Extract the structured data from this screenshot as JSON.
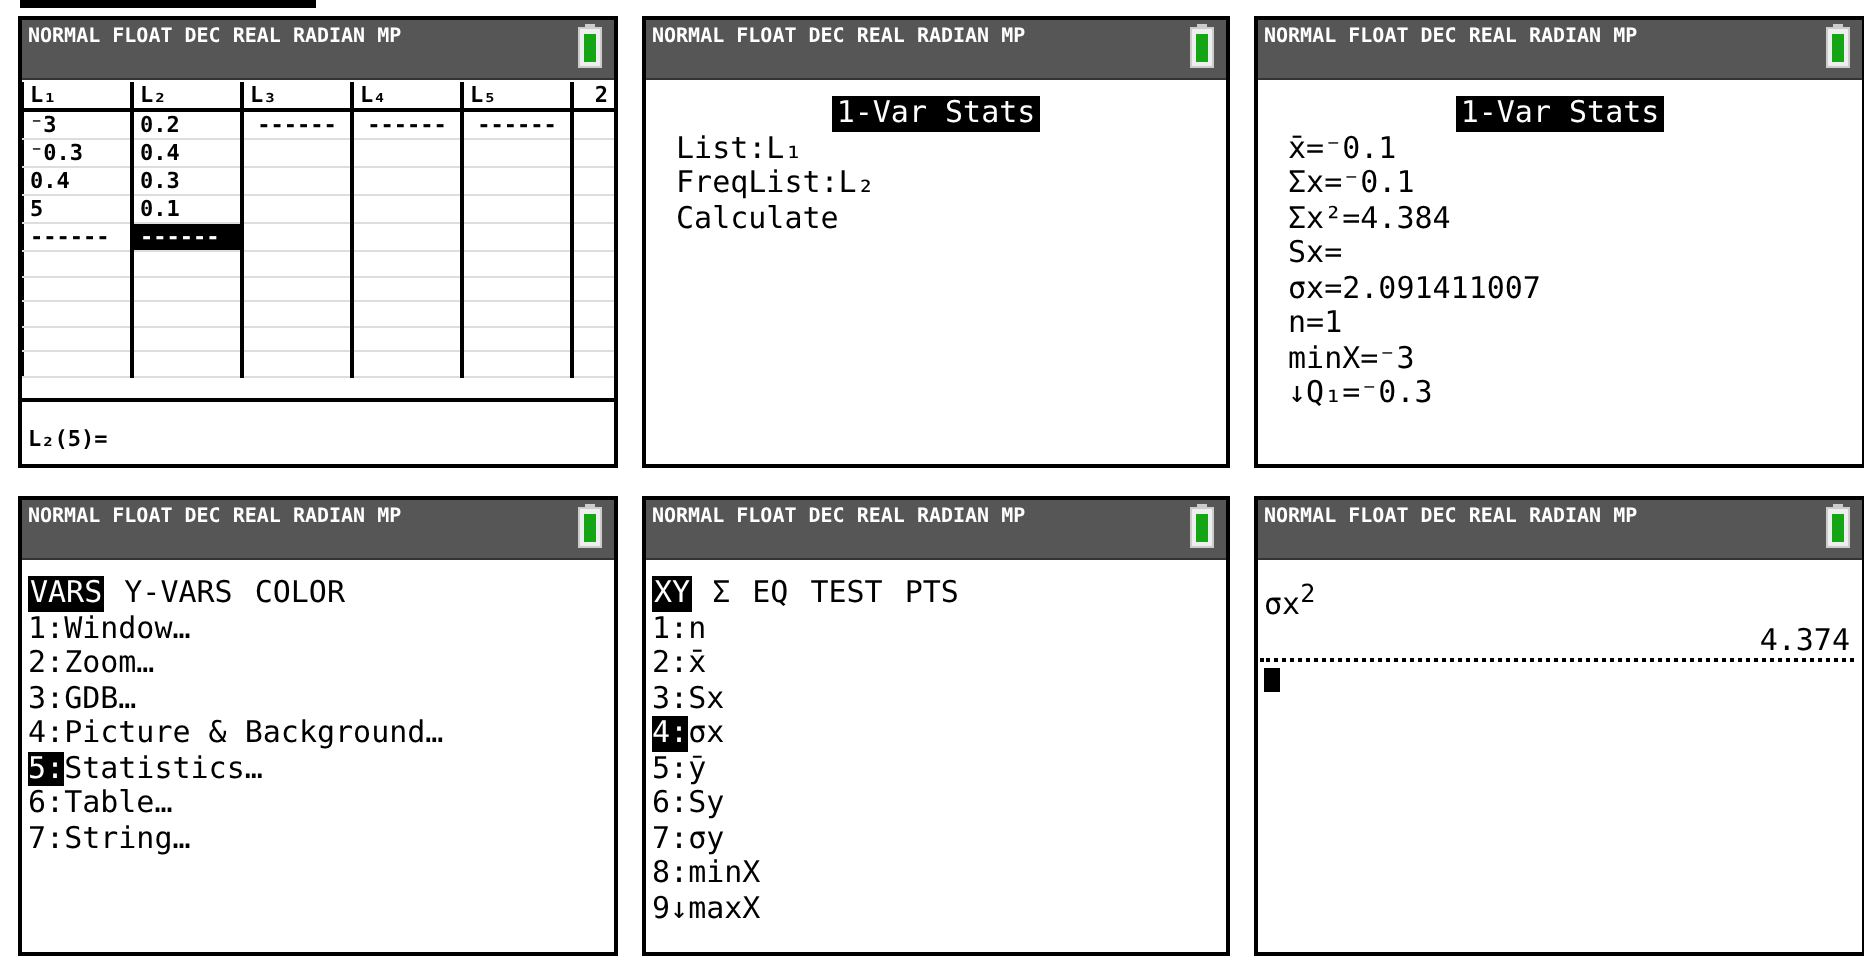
{
  "screens": [
    {
      "kind": "list_editor",
      "status": "NORMAL FLOAT DEC REAL RADIAN MP",
      "columns": [
        {
          "header": "L₁",
          "cells": [
            {
              "text": "⁻3",
              "selected": false
            },
            {
              "text": "⁻0.3",
              "selected": false
            },
            {
              "text": "0.4",
              "selected": false
            },
            {
              "text": "5",
              "selected": false
            },
            {
              "text": "------",
              "selected": false
            }
          ]
        },
        {
          "header": "L₂",
          "cells": [
            {
              "text": "0.2",
              "selected": false
            },
            {
              "text": "0.4",
              "selected": false
            },
            {
              "text": "0.3",
              "selected": false
            },
            {
              "text": "0.1",
              "selected": false
            },
            {
              "text": "------",
              "selected": true
            }
          ]
        },
        {
          "header": "L₃",
          "cells": [
            {
              "text": "------",
              "selected": false
            }
          ]
        },
        {
          "header": "L₄",
          "cells": [
            {
              "text": "------",
              "selected": false
            }
          ]
        },
        {
          "header": "L₅",
          "cells": [
            {
              "text": "------",
              "selected": false
            }
          ]
        },
        {
          "header": "2"
        }
      ],
      "entry": "L₂(5)="
    },
    {
      "kind": "stats",
      "status": "NORMAL FLOAT DEC REAL RADIAN MP",
      "title": "1-Var Stats",
      "lines": [
        "List:L₁",
        "FreqList:L₂",
        "Calculate"
      ]
    },
    {
      "kind": "stats",
      "status": "NORMAL FLOAT DEC REAL RADIAN MP",
      "title": "1-Var Stats",
      "lines": [
        "x̄=⁻0.1",
        "Σx=⁻0.1",
        "Σx²=4.384",
        "Sx=",
        "σx=2.091411007",
        "n=1",
        "minX=⁻3",
        "↓Q₁=⁻0.3"
      ]
    },
    {
      "kind": "menu",
      "status": "NORMAL FLOAT DEC REAL RADIAN MP",
      "tabs": [
        {
          "label": "VARS",
          "selected": true
        },
        {
          "label": "Y-VARS",
          "selected": false
        },
        {
          "label": "COLOR",
          "selected": false
        }
      ],
      "items": [
        {
          "number": "1",
          "separator": ":",
          "label": "Window…",
          "selected": false
        },
        {
          "number": "2",
          "separator": ":",
          "label": "Zoom…",
          "selected": false
        },
        {
          "number": "3",
          "separator": ":",
          "label": "GDB…",
          "selected": false
        },
        {
          "number": "4",
          "separator": ":",
          "label": "Picture & Background…",
          "selected": false
        },
        {
          "number": "5",
          "separator": ":",
          "label": "Statistics…",
          "selected": true
        },
        {
          "number": "6",
          "separator": ":",
          "label": "Table…",
          "selected": false
        },
        {
          "number": "7",
          "separator": ":",
          "label": "String…",
          "selected": false
        }
      ]
    },
    {
      "kind": "menu",
      "status": "NORMAL FLOAT DEC REAL RADIAN MP",
      "tabs": [
        {
          "label": "XY",
          "selected": true
        },
        {
          "label": "Σ",
          "selected": false
        },
        {
          "label": "EQ",
          "selected": false
        },
        {
          "label": "TEST",
          "selected": false
        },
        {
          "label": "PTS",
          "selected": false
        }
      ],
      "items": [
        {
          "number": "1",
          "separator": ":",
          "label": "n",
          "selected": false
        },
        {
          "number": "2",
          "separator": ":",
          "label": "x̄",
          "selected": false
        },
        {
          "number": "3",
          "separator": ":",
          "label": "Sx",
          "selected": false
        },
        {
          "number": "4",
          "separator": ":",
          "label": "σx",
          "selected": true
        },
        {
          "number": "5",
          "separator": ":",
          "label": "ȳ",
          "selected": false
        },
        {
          "number": "6",
          "separator": ":",
          "label": "Sy",
          "selected": false
        },
        {
          "number": "7",
          "separator": ":",
          "label": "σy",
          "selected": false
        },
        {
          "number": "8",
          "separator": ":",
          "label": "minX",
          "selected": false
        },
        {
          "number": "9",
          "separator": "↓",
          "label": "maxX",
          "selected": false
        }
      ]
    },
    {
      "kind": "home",
      "status": "NORMAL FLOAT DEC REAL RADIAN MP",
      "entry": "σx$^{2}$",
      "result": "4.374"
    }
  ]
}
